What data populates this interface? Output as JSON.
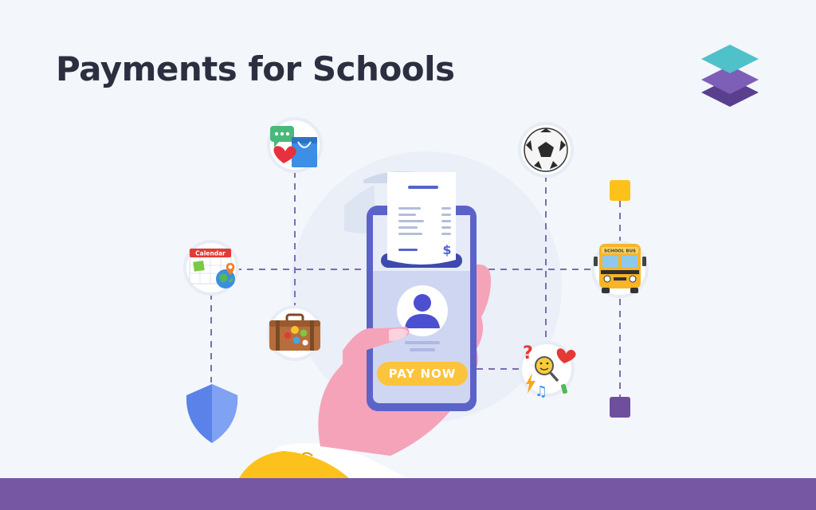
{
  "page": {
    "title": "Payments for Schools"
  },
  "phone": {
    "pay_button_label": "PAY NOW",
    "receipt_currency": "$"
  },
  "calendar": {
    "label": "Calendar"
  },
  "bus": {
    "label": "SCHOOL BUS"
  },
  "colors": {
    "background": "#f3f6fb",
    "footer": "#7557a4",
    "title": "#2b2f3f",
    "phone_frame": "#5b63c9",
    "pay_button": "#fcc33c",
    "connector": "#7d6eb0",
    "node_yellow": "#fcc21b",
    "node_purple": "#6e4f9e"
  },
  "icons": [
    "layers-logo-icon",
    "chat-shopping-icon",
    "soccer-ball-icon",
    "calendar-globe-icon",
    "suitcase-icon",
    "school-bus-icon",
    "shield-icon",
    "emoji-interests-icon",
    "receipt-icon",
    "user-avatar-icon",
    "hand-icon"
  ]
}
